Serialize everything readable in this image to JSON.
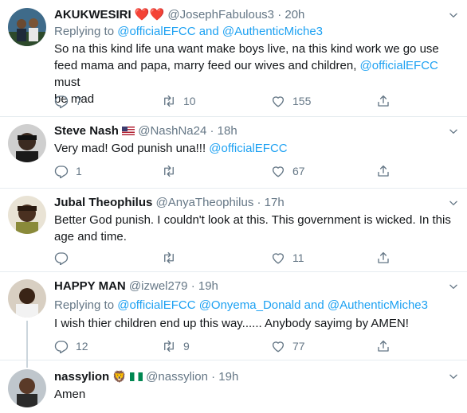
{
  "tweets": [
    {
      "name": "AKUKWESIRI",
      "name_emoji": "❤️❤️",
      "handle": "@JosephFabulous3",
      "time": "20h",
      "reply_prefix": "Replying to",
      "reply_to": "@officialEFCC and @AuthenticMiche3",
      "body_line1": "So na this kind life una want make boys live, na this kind work we go use",
      "body_line2": "feed mama and papa, marry feed our wives and children,",
      "body_mention": "@officialEFCC",
      "body_line2_end": "must",
      "body_line3": "be mad",
      "replies": "7",
      "retweets": "10",
      "likes": "155"
    },
    {
      "name": "Steve Nash",
      "handle": "@NashNa24",
      "time": "18h",
      "body_text": "Very mad! God punish una!!!",
      "body_mention": "@officialEFCC",
      "replies": "1",
      "retweets": "",
      "likes": "67"
    },
    {
      "name": "Jubal Theophilus",
      "handle": "@AnyaTheophilus",
      "time": "17h",
      "body_line1": "Better God punish. I couldn't look at this. This government is wicked. In this",
      "body_line2": "age and time.",
      "replies": "",
      "retweets": "",
      "likes": "11"
    },
    {
      "name": "HAPPY MAN",
      "handle": "@izwel279",
      "time": "19h",
      "reply_prefix": "Replying to",
      "reply_to": "@officialEFCC @Onyema_Donald and @AuthenticMiche3",
      "body_text": "I wish thier children end up this way...... Anybody sayimg by AMEN!",
      "replies": "12",
      "retweets": "9",
      "likes": "77"
    },
    {
      "name": "nassylion",
      "name_emoji": "🦁",
      "handle": "@nassylion",
      "time": "19h",
      "body_text": "Amen"
    }
  ],
  "separator": "·",
  "colors": {
    "link": "#1da1f2",
    "muted": "#657786",
    "text": "#14171a",
    "border": "#e6ecf0"
  },
  "icons": [
    "reply-icon",
    "retweet-icon",
    "like-icon",
    "share-icon",
    "caret-down-icon",
    "us-flag-icon",
    "nigeria-flag-icon"
  ]
}
